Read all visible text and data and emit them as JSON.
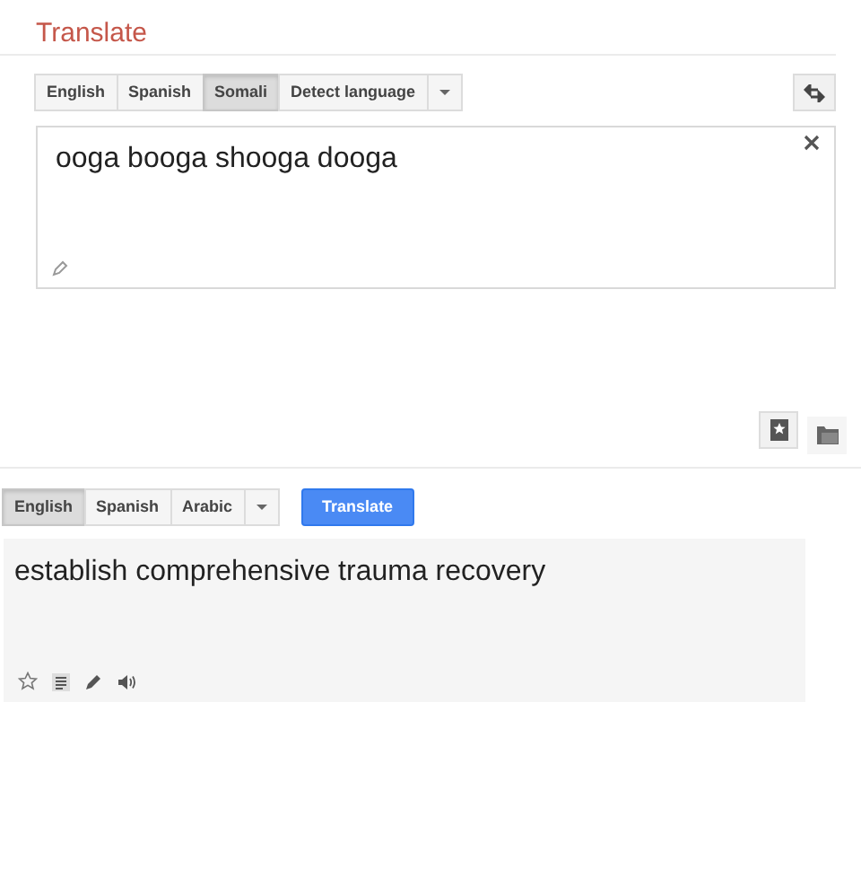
{
  "title": "Translate",
  "source_languages": [
    {
      "label": "English",
      "selected": false
    },
    {
      "label": "Spanish",
      "selected": false
    },
    {
      "label": "Somali",
      "selected": true
    },
    {
      "label": "Detect language",
      "selected": false
    }
  ],
  "source_text": "ooga booga shooga dooga",
  "target_languages": [
    {
      "label": "English",
      "selected": true
    },
    {
      "label": "Spanish",
      "selected": false
    },
    {
      "label": "Arabic",
      "selected": false
    }
  ],
  "translate_button": "Translate",
  "translation": "establish comprehensive trauma recovery"
}
